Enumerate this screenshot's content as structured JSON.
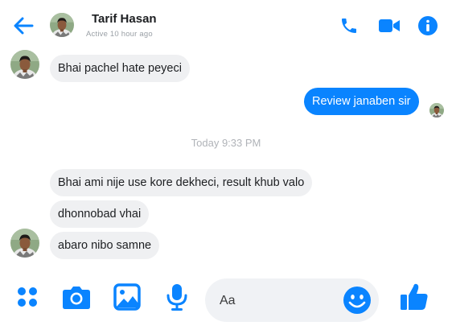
{
  "colors": {
    "accent": "#0a84ff",
    "bubble_in": "#eff0f2",
    "bubble_out": "#0a84ff",
    "timestamp": "#b0b3b8"
  },
  "header": {
    "back_icon": "arrow-left-icon",
    "name": "Tarif Hasan",
    "status": "Active 10 hour ago",
    "actions": [
      {
        "icon": "phone-icon"
      },
      {
        "icon": "video-camera-icon"
      },
      {
        "icon": "info-icon"
      }
    ]
  },
  "messages": {
    "m1": "Bhai pachel hate peyeci",
    "m2": "Review janaben sir",
    "timestamp": "Today 9:33 PM",
    "m3": "Bhai ami nije use kore dekheci, result khub valo",
    "m4": "dhonnobad vhai",
    "m5": "abaro nibo samne"
  },
  "composer": {
    "icons": [
      "grid-dots-icon",
      "camera-icon",
      "image-icon",
      "microphone-icon",
      "emoji-icon",
      "thumbs-up-icon"
    ],
    "placeholder": "Aa"
  }
}
